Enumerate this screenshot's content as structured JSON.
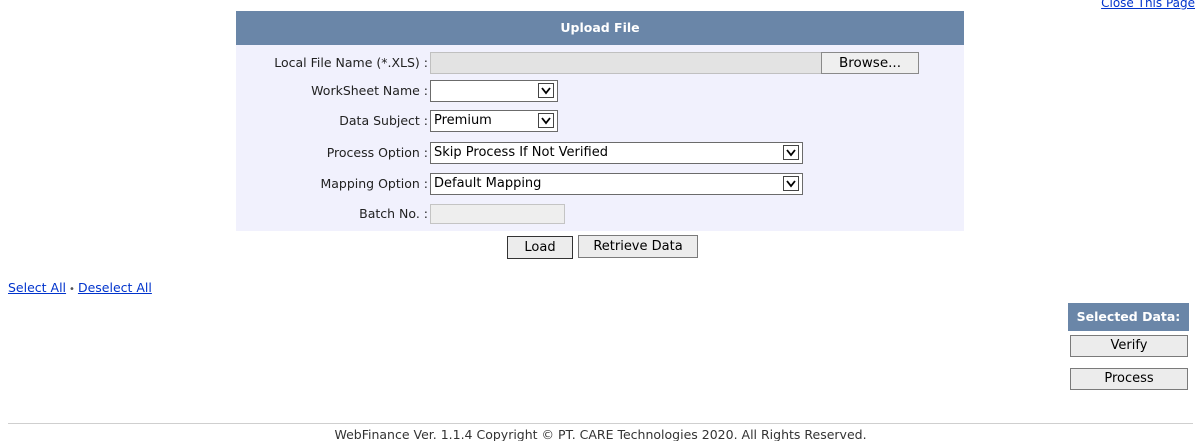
{
  "header_links": {
    "close_page": "Close This Page"
  },
  "upload": {
    "title": "Upload File",
    "file_label": "Local File Name (*.XLS) :",
    "file_value": "",
    "browse_label": "Browse...",
    "worksheet_label": "WorkSheet Name :",
    "worksheet_value": "",
    "subject_label": "Data Subject :",
    "subject_value": "Premium",
    "process_label": "Process Option :",
    "process_value": "Skip Process If Not Verified",
    "mapping_label": "Mapping Option :",
    "mapping_value": "Default Mapping",
    "batch_label": "Batch No. :",
    "batch_value": ""
  },
  "actions": {
    "load": "Load",
    "retrieve": "Retrieve Data"
  },
  "selection": {
    "select_all": "Select All",
    "separator": "•",
    "deselect_all": "Deselect All"
  },
  "side": {
    "header": "Selected Data:",
    "verify": "Verify",
    "process": "Process"
  },
  "footer": {
    "text": "WebFinance Ver. 1.1.4 Copyright © PT. CARE Technologies 2020. All Rights Reserved."
  },
  "icons": {
    "dropdown": "chevron-down-icon"
  }
}
